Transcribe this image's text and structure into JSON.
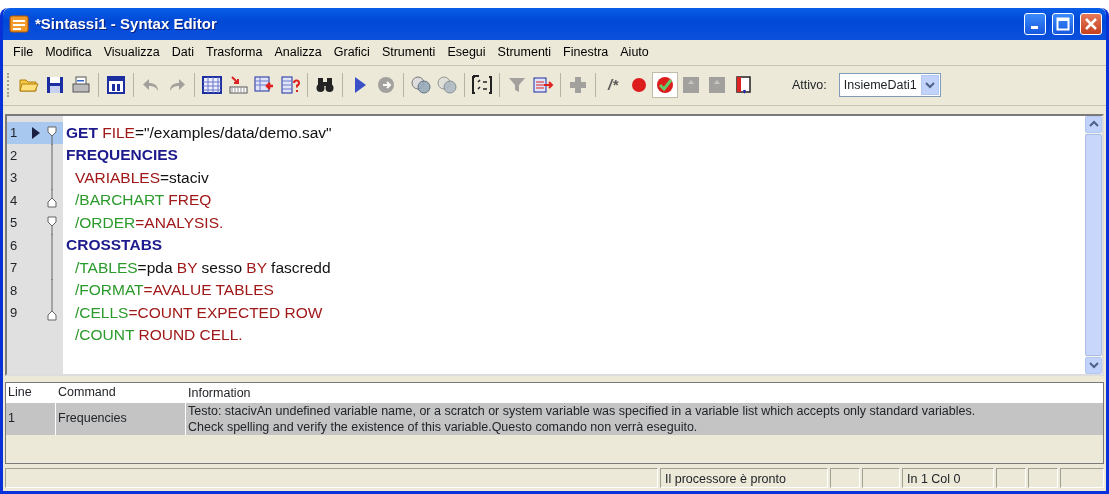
{
  "window": {
    "title": "*Sintassi1 - Syntax Editor"
  },
  "menu": [
    "File",
    "Modifica",
    "Visualizza",
    "Dati",
    "Trasforma",
    "Analizza",
    "Grafici",
    "Strumenti",
    "Esegui",
    "Strumenti",
    "Finestra",
    "Aiuto"
  ],
  "toolbar": [
    [
      {
        "kind": "open",
        "disabled": false
      },
      {
        "kind": "save",
        "disabled": false
      },
      {
        "kind": "print",
        "disabled": false
      }
    ],
    [
      {
        "kind": "dialog",
        "disabled": false
      }
    ],
    [
      {
        "kind": "undo",
        "disabled": true
      },
      {
        "kind": "redo",
        "disabled": true
      }
    ],
    [
      {
        "kind": "grid",
        "disabled": false
      },
      {
        "kind": "gotocase",
        "disabled": false
      },
      {
        "kind": "insert",
        "disabled": false
      },
      {
        "kind": "varinfo",
        "disabled": false
      }
    ],
    [
      {
        "kind": "find",
        "disabled": false
      }
    ],
    [
      {
        "kind": "run",
        "disabled": false
      },
      {
        "kind": "step",
        "disabled": true
      }
    ],
    [
      {
        "kind": "sets",
        "disabled": false
      },
      {
        "kind": "sets",
        "disabled": true
      }
    ],
    [
      {
        "kind": "brackets",
        "disabled": false
      }
    ],
    [
      {
        "kind": "funnel",
        "disabled": true
      },
      {
        "kind": "export",
        "disabled": false
      }
    ],
    [
      {
        "kind": "plus",
        "disabled": true
      }
    ],
    [
      {
        "kind": "text",
        "label": "/*",
        "disabled": false
      },
      {
        "kind": "breakpoint",
        "disabled": false
      },
      {
        "kind": "check",
        "disabled": false,
        "pressed": true
      },
      {
        "kind": "bookmark",
        "disabled": true
      },
      {
        "kind": "bookmark",
        "disabled": true
      },
      {
        "kind": "book",
        "disabled": false
      }
    ]
  ],
  "active": {
    "label": "Attivo:",
    "value": "InsiemeDati1"
  },
  "editor": {
    "lines": [
      {
        "number": "1",
        "current": true,
        "fold_start": true,
        "fold_end": false,
        "indent": false,
        "tokens": [
          {
            "t": "GET",
            "kind": "command"
          },
          {
            "t": " FILE",
            "kind": "keyword"
          },
          {
            "t": "=\"/examples/data/demo.sav\"",
            "kind": "plain"
          }
        ]
      },
      {
        "number": "2",
        "current": false,
        "fold_start": false,
        "fold_end": false,
        "indent": false,
        "tokens": [
          {
            "t": "FREQUENCIES",
            "kind": "command"
          }
        ]
      },
      {
        "number": "3",
        "current": false,
        "fold_start": false,
        "fold_end": false,
        "indent": true,
        "tokens": [
          {
            "t": "VARIABLES",
            "kind": "keyword"
          },
          {
            "t": "=staciv",
            "kind": "plain"
          }
        ]
      },
      {
        "number": "4",
        "current": false,
        "fold_start": false,
        "fold_end": true,
        "indent": true,
        "tokens": [
          {
            "t": "/BARCHART",
            "kind": "subcommand"
          },
          {
            "t": " FREQ",
            "kind": "keyword"
          }
        ]
      },
      {
        "number": "5",
        "current": false,
        "fold_start": true,
        "fold_end": false,
        "indent": true,
        "tokens": [
          {
            "t": "/ORDER",
            "kind": "subcommand"
          },
          {
            "t": "=ANALYSIS.",
            "kind": "keyword"
          }
        ]
      },
      {
        "number": "6",
        "current": false,
        "fold_start": false,
        "fold_end": false,
        "indent": false,
        "tokens": [
          {
            "t": "CROSSTABS",
            "kind": "command"
          }
        ]
      },
      {
        "number": "7",
        "current": false,
        "fold_start": false,
        "fold_end": false,
        "indent": true,
        "tokens": [
          {
            "t": "/TABLES",
            "kind": "subcommand"
          },
          {
            "t": "=pda ",
            "kind": "plain"
          },
          {
            "t": "BY",
            "kind": "keyword"
          },
          {
            "t": " sesso ",
            "kind": "plain"
          },
          {
            "t": "BY",
            "kind": "keyword"
          },
          {
            "t": " fascredd",
            "kind": "plain"
          }
        ]
      },
      {
        "number": "8",
        "current": false,
        "fold_start": false,
        "fold_end": false,
        "indent": true,
        "tokens": [
          {
            "t": "/FORMAT",
            "kind": "subcommand"
          },
          {
            "t": "=AVALUE TABLES",
            "kind": "keyword"
          }
        ]
      },
      {
        "number": "9",
        "current": false,
        "fold_start": false,
        "fold_end": true,
        "indent": true,
        "tokens": [
          {
            "t": "/CELLS",
            "kind": "subcommand"
          },
          {
            "t": "=COUNT EXPECTED ROW",
            "kind": "keyword"
          }
        ]
      },
      {
        "current": false,
        "fold_start": false,
        "fold_end": false,
        "indent": true,
        "tokens": [
          {
            "t": "/COUNT",
            "kind": "subcommand"
          },
          {
            "t": " ROUND CELL.",
            "kind": "keyword"
          }
        ]
      }
    ]
  },
  "messages": {
    "columns": [
      "Line",
      "Command",
      "Information"
    ],
    "rows": [
      {
        "selected": true,
        "cells": [
          "1",
          "Frequencies",
          "Testo: stacivAn undefined variable name, or a scratch or system variable was specified in a variable list which accepts only standard variables.\nCheck spelling and verify the existence of this variable.Questo comando non verrà eseguito."
        ]
      }
    ]
  },
  "status_bar": {
    "cells": [
      "",
      "Il processore è pronto",
      "",
      "",
      "In 1 Col 0",
      "",
      "",
      ""
    ]
  }
}
